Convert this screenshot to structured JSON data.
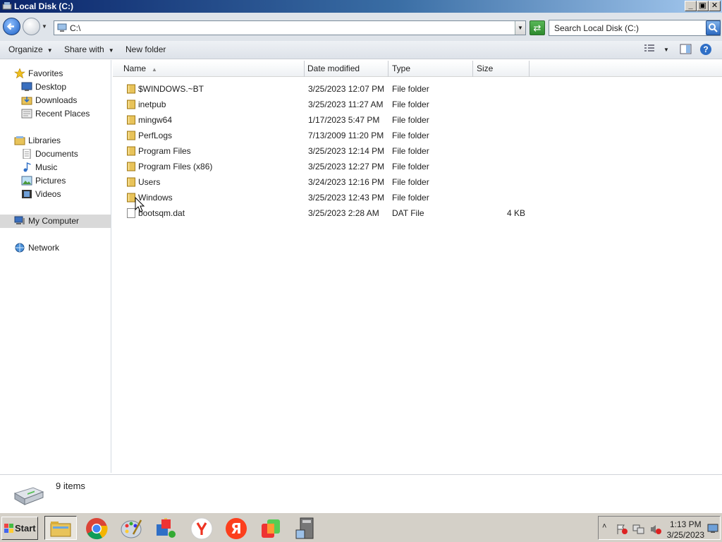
{
  "window": {
    "title": "Local Disk (C:)"
  },
  "address": {
    "path": "C:\\",
    "search_placeholder": "Search Local Disk (C:)"
  },
  "toolbar": {
    "organize": "Organize",
    "share_with": "Share with",
    "new_folder": "New folder"
  },
  "nav": {
    "favorites": "Favorites",
    "desktop": "Desktop",
    "downloads": "Downloads",
    "recent": "Recent Places",
    "libraries": "Libraries",
    "documents": "Documents",
    "music": "Music",
    "pictures": "Pictures",
    "videos": "Videos",
    "mycomputer": "My Computer",
    "network": "Network"
  },
  "columns": {
    "name": "Name",
    "date": "Date modified",
    "type": "Type",
    "size": "Size"
  },
  "files": [
    {
      "name": "$WINDOWS.~BT",
      "date": "3/25/2023 12:07 PM",
      "type": "File folder",
      "size": ""
    },
    {
      "name": "inetpub",
      "date": "3/25/2023 11:27 AM",
      "type": "File folder",
      "size": ""
    },
    {
      "name": "mingw64",
      "date": "1/17/2023 5:47 PM",
      "type": "File folder",
      "size": ""
    },
    {
      "name": "PerfLogs",
      "date": "7/13/2009 11:20 PM",
      "type": "File folder",
      "size": ""
    },
    {
      "name": "Program Files",
      "date": "3/25/2023 12:14 PM",
      "type": "File folder",
      "size": ""
    },
    {
      "name": "Program Files (x86)",
      "date": "3/25/2023 12:27 PM",
      "type": "File folder",
      "size": ""
    },
    {
      "name": "Users",
      "date": "3/24/2023 12:16 PM",
      "type": "File folder",
      "size": ""
    },
    {
      "name": "Windows",
      "date": "3/25/2023 12:43 PM",
      "type": "File folder",
      "size": ""
    },
    {
      "name": "bootsqm.dat",
      "date": "3/25/2023 2:28 AM",
      "type": "DAT File",
      "size": "4 KB"
    }
  ],
  "details": {
    "count": "9 items"
  },
  "taskbar": {
    "start": "Start",
    "time": "1:13 PM",
    "date": "3/25/2023"
  },
  "colors": {
    "title_start": "#0a246a",
    "taskbar": "#d4d0c8",
    "folder": "#e8c35a"
  }
}
